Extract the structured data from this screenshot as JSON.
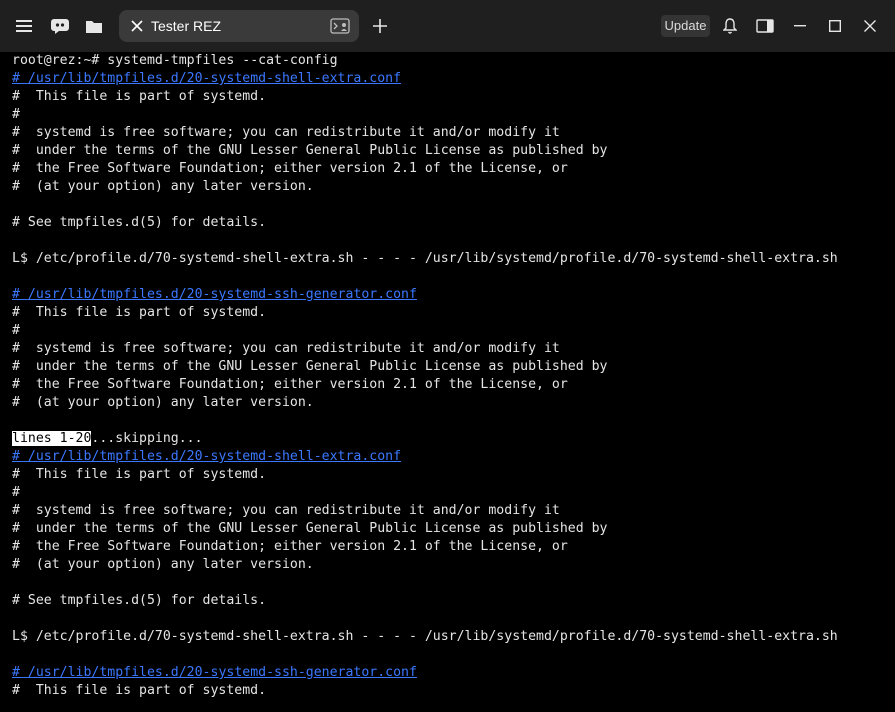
{
  "window": {
    "tab_title": "Tester REZ",
    "update_label": "Update",
    "accent": "#3b78ff"
  },
  "icons": {
    "menu": "hamburger-menu-icon",
    "ai": "ai-assistant-icon",
    "folder": "folder-icon",
    "tab_close": "close-icon",
    "tab_terminal": "terminal-icon",
    "new_tab": "plus-icon",
    "bell": "bell-icon",
    "sidebar": "sidebar-toggle-icon",
    "minimize": "minimize-icon",
    "maximize": "maximize-icon",
    "close": "close-window-icon"
  },
  "terminal": {
    "prompt": "root@rez:~# ",
    "command": "systemd-tmpfiles --cat-config",
    "path_shell_extra": "/usr/lib/tmpfiles.d/20-systemd-shell-extra.conf",
    "path_ssh_generator": "/usr/lib/tmpfiles.d/20-systemd-ssh-generator.conf",
    "comment_part": "#  This file is part of systemd.",
    "comment_blank": "#",
    "comment_free": "#  systemd is free software; you can redistribute it and/or modify it",
    "comment_terms": "#  under the terms of the GNU Lesser General Public License as published by",
    "comment_fsf": "#  the Free Software Foundation; either version 2.1 of the License, or",
    "comment_later": "#  (at your option) any later version.",
    "comment_see": "# See tmpfiles.d(5) for details.",
    "symlink_line": "L$ /etc/profile.d/70-systemd-shell-extra.sh - - - - /usr/lib/systemd/profile.d/70-systemd-shell-extra.sh",
    "pager_highlight": "lines 1-20",
    "pager_rest": "...skipping..."
  }
}
